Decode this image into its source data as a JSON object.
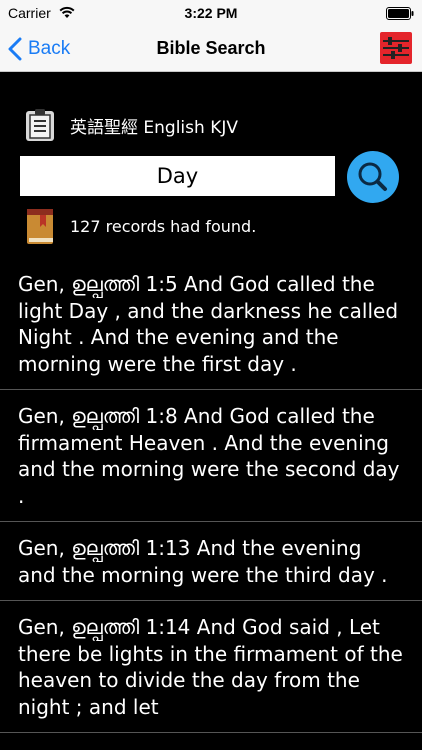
{
  "status_bar": {
    "carrier": "Carrier",
    "time": "3:22 PM"
  },
  "nav": {
    "back_label": "Back",
    "title": "Bible Search"
  },
  "version": {
    "label": "英語聖經 English KJV"
  },
  "search": {
    "value": "Day"
  },
  "result_summary": "127 records had found.",
  "verses": [
    {
      "text": "Gen, ഉല്പത്തി 1:5 And God called the light Day , and the darkness he called Night . And the evening and the morning were the first day ."
    },
    {
      "text": "Gen, ഉല്പത്തി 1:8 And God called the firmament Heaven . And the evening and the morning were the second day ."
    },
    {
      "text": "Gen, ഉല്പത്തി 1:13 And the evening and the morning were the third day ."
    },
    {
      "text": "Gen, ഉല്പത്തി 1:14 And God said , Let there be lights in the firmament of the heaven to divide the day from the night ; and let"
    }
  ],
  "colors": {
    "accent": "#1a7cf5",
    "search_button": "#31a8f0",
    "settings_button": "#e4252b",
    "background": "#000000"
  },
  "icons": {
    "wifi": "wifi-icon",
    "battery": "battery-icon",
    "back": "chevron-left-icon",
    "settings": "sliders-icon",
    "version": "clipboard-icon",
    "search": "magnifier-icon",
    "result": "book-icon"
  }
}
